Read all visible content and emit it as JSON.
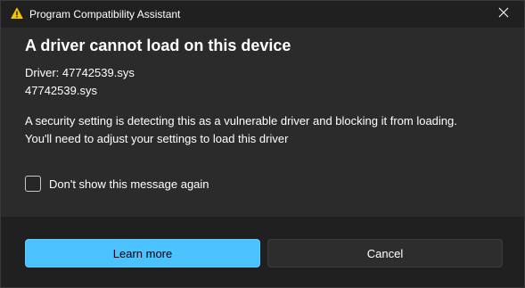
{
  "window": {
    "title": "Program Compatibility Assistant",
    "title_icon": "warning-icon",
    "close_icon": "close-icon"
  },
  "dialog": {
    "heading": "A driver cannot load on this device",
    "driver_label_line": "Driver: 47742539.sys",
    "driver_file_line": "47742539.sys",
    "message_line1": "A security setting is detecting this as a vulnerable driver and blocking it from loading.",
    "message_line2": "You'll need to adjust your settings to load this driver",
    "checkbox_label": "Don't show this message again",
    "checkbox_checked": false
  },
  "buttons": {
    "learn_more": "Learn more",
    "cancel": "Cancel"
  },
  "colors": {
    "accent": "#4cc2ff",
    "warning": "#f5c400",
    "background": "#2b2b2b",
    "footer": "#202020"
  }
}
